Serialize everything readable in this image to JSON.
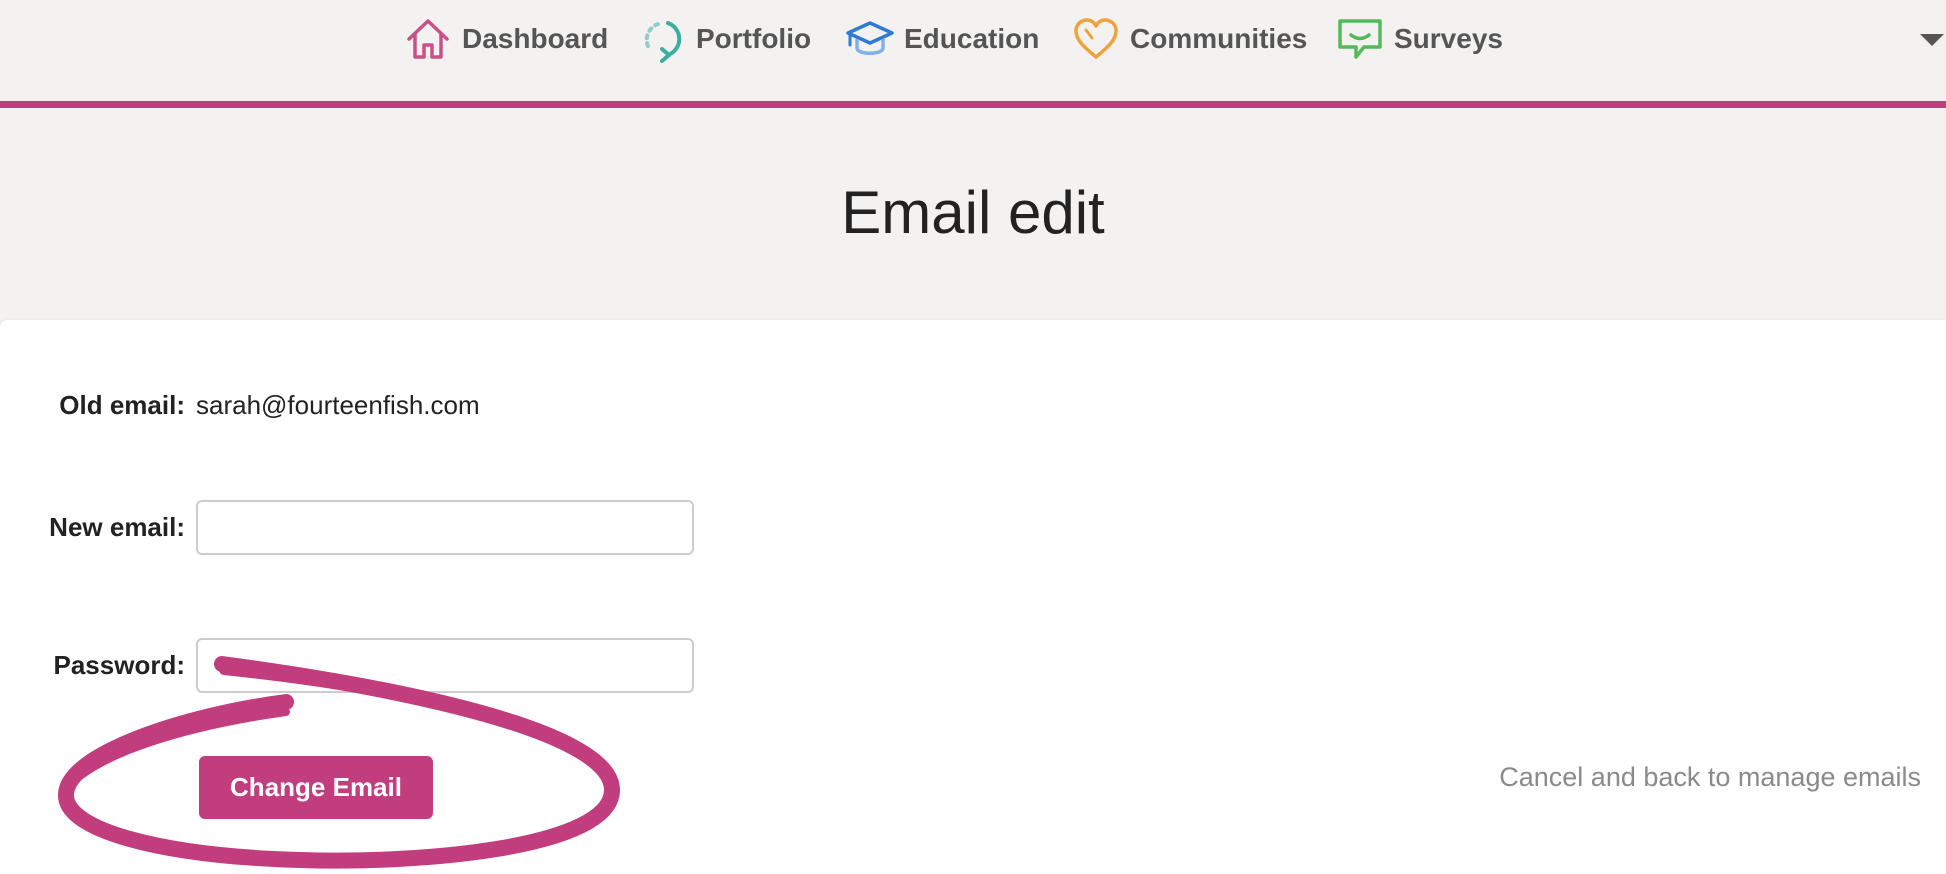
{
  "nav": {
    "items": [
      {
        "label": "Dashboard",
        "icon": "home-icon",
        "color": "#c9508a"
      },
      {
        "label": "Portfolio",
        "icon": "refresh-icon",
        "color": "#3aaea0"
      },
      {
        "label": "Education",
        "icon": "graduation-cap-icon",
        "color": "#2f7bd3"
      },
      {
        "label": "Communities",
        "icon": "heart-icon",
        "color": "#f0a23a"
      },
      {
        "label": "Surveys",
        "icon": "chat-bubble-icon",
        "color": "#55b85a"
      }
    ],
    "accent_color": "#c23d7e",
    "menu_icon": "caret-down-icon"
  },
  "page": {
    "title": "Email edit"
  },
  "form": {
    "old_email_label": "Old email:",
    "old_email_value": "sarah@fourteenfish.com",
    "new_email_label": "New email:",
    "new_email_value": "",
    "password_label": "Password:",
    "password_value": "",
    "submit_label": "Change Email",
    "cancel_label": "Cancel and back to manage emails"
  },
  "annotation": {
    "type": "hand-drawn circle highlight",
    "color": "#c23d7e"
  }
}
